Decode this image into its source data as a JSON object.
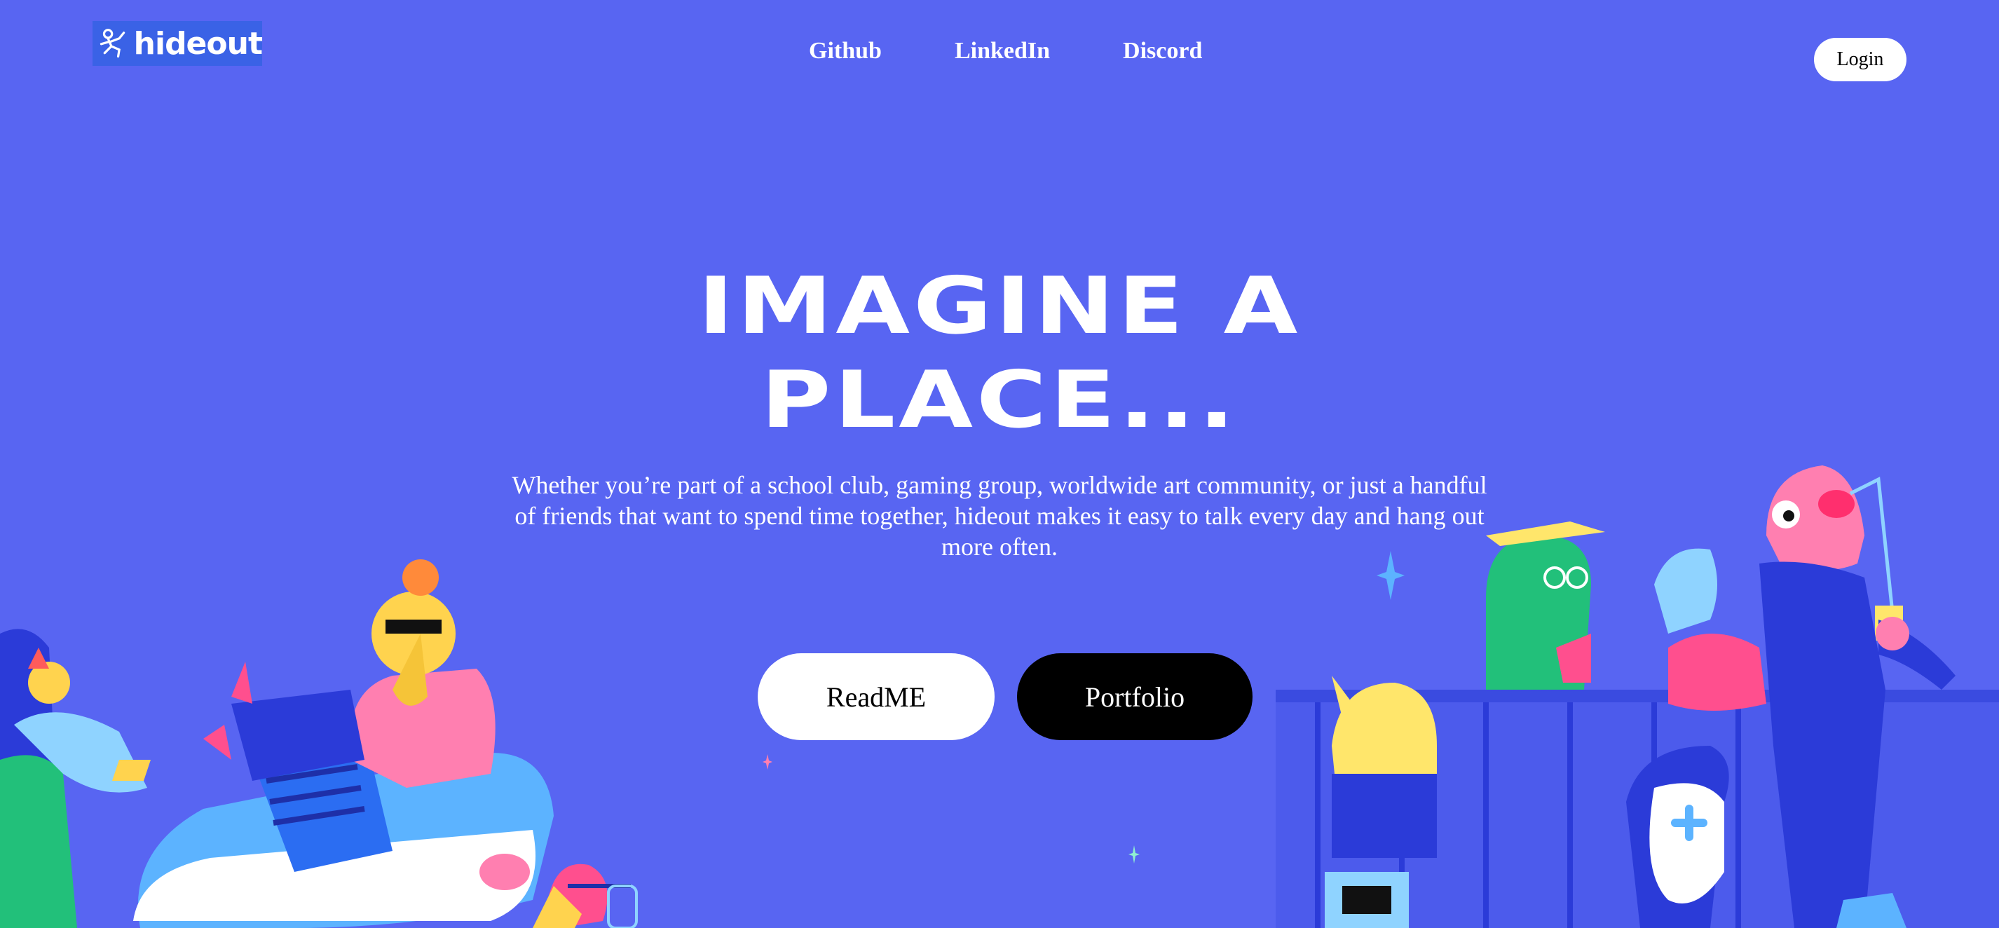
{
  "brand": {
    "logo_text": "hideout"
  },
  "nav": {
    "items": [
      "Github",
      "LinkedIn",
      "Discord"
    ]
  },
  "header": {
    "login_label": "Login"
  },
  "hero": {
    "headline_line1": "IMAGINE A",
    "headline_line2": "PLACE...",
    "subtext": "Whether you’re part of a school club, gaming group, worldwide art community, or just a handful of friends that want to spend time together, hideout makes it easy to talk every day and hang out more often.",
    "primary_button": "ReadME",
    "secondary_button": "Portfolio"
  },
  "colors": {
    "background": "#5865f2",
    "logo_bg": "#3a62e6",
    "white": "#ffffff",
    "black": "#000000"
  },
  "icons": {
    "logo_mark": "hideout-logo-icon"
  }
}
